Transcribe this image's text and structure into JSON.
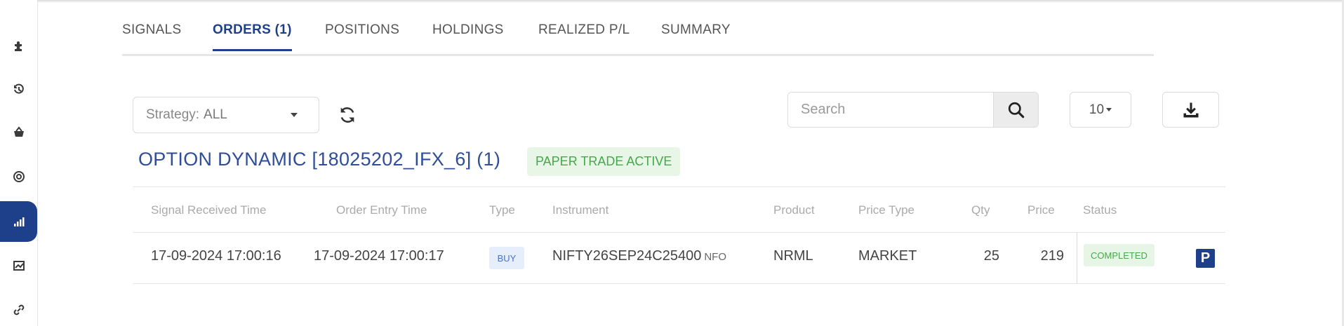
{
  "tabs": [
    {
      "label": "SIGNALS",
      "active": false
    },
    {
      "label": "ORDERS (1)",
      "active": true
    },
    {
      "label": "POSITIONS",
      "active": false
    },
    {
      "label": "HOLDINGS",
      "active": false
    },
    {
      "label": "REALIZED P/L",
      "active": false
    },
    {
      "label": "SUMMARY",
      "active": false
    }
  ],
  "sidebar": {
    "items": [
      {
        "icon": "puzzle-icon",
        "active": false
      },
      {
        "icon": "history-icon",
        "active": false
      },
      {
        "icon": "basket-icon",
        "active": false
      },
      {
        "icon": "target-icon",
        "active": false
      },
      {
        "icon": "signal-bars-icon",
        "active": true
      },
      {
        "icon": "chart-frame-icon",
        "active": false
      },
      {
        "icon": "link-icon",
        "active": false
      }
    ]
  },
  "toolbar": {
    "strategy_label": "Strategy:",
    "strategy_value": "ALL",
    "search_placeholder": "Search",
    "page_size": "10"
  },
  "strategy": {
    "title": "OPTION DYNAMIC [18025202_IFX_6] (1)",
    "badge": "PAPER TRADE ACTIVE"
  },
  "table": {
    "headers": [
      "Signal Received Time",
      "Order Entry Time",
      "Type",
      "Instrument",
      "Product",
      "Price Type",
      "Qty",
      "Price",
      "Status"
    ],
    "rows": [
      {
        "signal_time": "17-09-2024 17:00:16",
        "entry_time": "17-09-2024 17:00:17",
        "type": "BUY",
        "instrument": "NIFTY26SEP24C25400",
        "exchange": "NFO",
        "product": "NRML",
        "price_type": "MARKET",
        "qty": "25",
        "price": "219",
        "status": "COMPLETED",
        "action_icon": "P"
      }
    ]
  },
  "colors": {
    "accent": "#1e3f8a",
    "success": "#46a84a",
    "buy": "#4a72c4"
  }
}
